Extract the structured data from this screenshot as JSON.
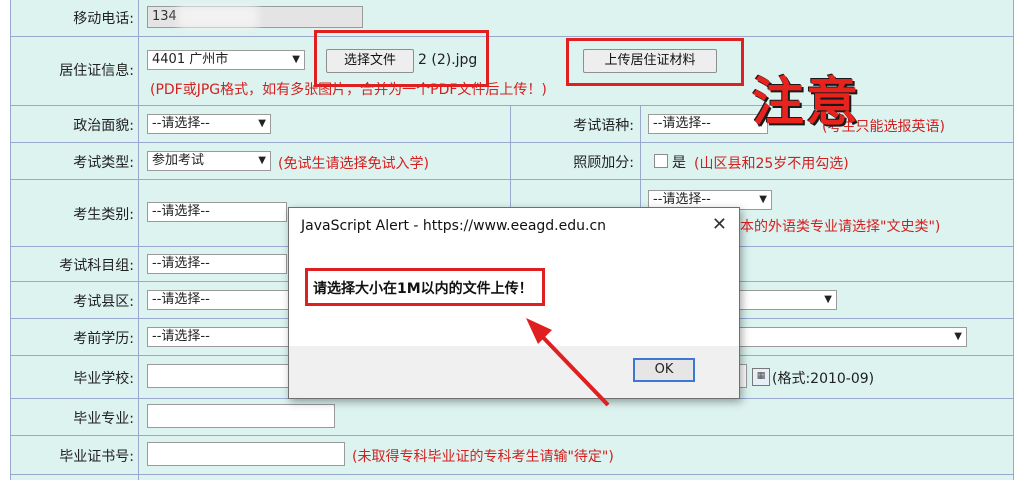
{
  "form": {
    "phone": {
      "label": "移动电话:",
      "value": "134"
    },
    "residence": {
      "label": "居住证信息:",
      "city": "4401 广州市",
      "choose_file_label": "选择文件",
      "file_name": "2 (2).jpg",
      "upload_label": "上传居住证材料",
      "hint": "(PDF或JPG格式，如有多张图片，合并为一个PDF文件后上传！)"
    },
    "political": {
      "label": "政治面貌:",
      "value": "--请选择--"
    },
    "language": {
      "label": "考试语种:",
      "value": "--请选择--",
      "hint": "(考生只能选报英语)"
    },
    "exam_type": {
      "label": "考试类型:",
      "value": "参加考试",
      "hint": "(免试生请选择免试入学)"
    },
    "bonus": {
      "label": "照顾加分:",
      "checkbox_label": "是",
      "hint": "(山区县和25岁不用勾选)"
    },
    "category": {
      "label": "考生类别:",
      "value": "--请选择--",
      "right_value": "--请选择--",
      "right_hint": "本的外语类专业请选择\"文史类\")"
    },
    "subject_group": {
      "label": "考试科目组:",
      "value": "--请选择--"
    },
    "county": {
      "label": "考试县区:",
      "value": "--请选择--"
    },
    "education": {
      "label": "考前学历:",
      "value": "--请选择--"
    },
    "school": {
      "label": "毕业学校:",
      "date_hint": "(格式:2010-09)"
    },
    "major": {
      "label": "毕业专业:"
    },
    "cert": {
      "label": "毕业证书号:",
      "hint": "(未取得专科毕业证的专科考生请输\"待定\")"
    }
  },
  "annotation": {
    "note": "注意"
  },
  "dialog": {
    "title": "JavaScript Alert - https://www.eeagd.edu.cn",
    "message": "请选择大小在1M以内的文件上传！",
    "ok_label": "OK"
  },
  "colors": {
    "form_bg": "#dcf3ef",
    "grid": "#98a8cf",
    "hint": "#d32020",
    "annotation": "#e8221c"
  }
}
